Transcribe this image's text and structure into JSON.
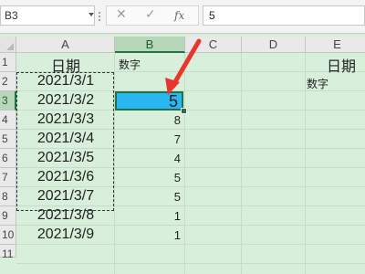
{
  "formula_bar": {
    "name_box": "B3",
    "cancel_icon": "✕",
    "enter_icon": "✓",
    "fx_icon": "fx",
    "formula_value": "5"
  },
  "grid": {
    "columns": [
      "A",
      "B",
      "C",
      "D",
      "E"
    ],
    "rows": [
      "1",
      "2",
      "3",
      "4",
      "5",
      "6",
      "7",
      "8",
      "9",
      "10",
      "11"
    ],
    "a_header": "日期",
    "b_header": "数字",
    "dates": [
      "2021/3/1",
      "2021/3/2",
      "2021/3/3",
      "2021/3/4",
      "2021/3/5",
      "2021/3/6",
      "2021/3/7",
      "2021/3/8",
      "2021/3/9"
    ],
    "numbers": [
      "5",
      "8",
      "7",
      "4",
      "5",
      "5",
      "1",
      "1"
    ],
    "selected_cell_value": "5",
    "e_header": "日期",
    "e_sub": "数字"
  },
  "colors": {
    "sheet_background": "#d8efdc",
    "selection_fill": "#2ab6f0",
    "selection_border": "#217346",
    "annotation_arrow": "#e8352e"
  }
}
